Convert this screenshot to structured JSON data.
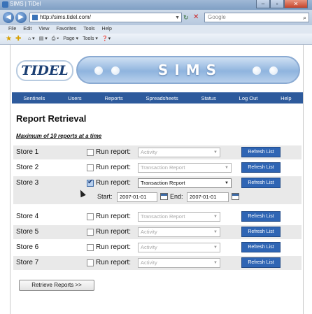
{
  "window": {
    "title": "SIMS | TiDel"
  },
  "browser": {
    "url": "http://sims.tidel.com/",
    "search_placeholder": "Google",
    "menu": [
      "File",
      "Edit",
      "View",
      "Favorites",
      "Tools",
      "Help"
    ],
    "command": [
      "Page ▾",
      "Tools ▾",
      "❓▾"
    ]
  },
  "banner": {
    "logo": "TIDEL",
    "app_name": "SIMS"
  },
  "nav": [
    "Sentinels",
    "Users",
    "Reports",
    "Spreadsheets",
    "Status",
    "Log Out",
    "Help"
  ],
  "page": {
    "title": "Report Retrieval",
    "note": "Maximum of 10 reports at a time",
    "run_label": "Run report:",
    "refresh_label": "Refresh List",
    "start_label": "Start:",
    "end_label": "End:",
    "retrieve_label": "Retrieve Reports >>"
  },
  "stores": [
    {
      "name": "Store 1",
      "checked": false,
      "report": "Activity"
    },
    {
      "name": "Store 2",
      "checked": false,
      "report": "Transaction Report"
    },
    {
      "name": "Store 3",
      "checked": true,
      "report": "Transaction Report",
      "start": "2007-01-01",
      "end": "2007-01-01"
    },
    {
      "name": "Store 4",
      "checked": false,
      "report": "Transaction Report"
    },
    {
      "name": "Store 5",
      "checked": false,
      "report": "Activity"
    },
    {
      "name": "Store 6",
      "checked": false,
      "report": "Activity"
    },
    {
      "name": "Store 7",
      "checked": false,
      "report": "Activity"
    }
  ]
}
